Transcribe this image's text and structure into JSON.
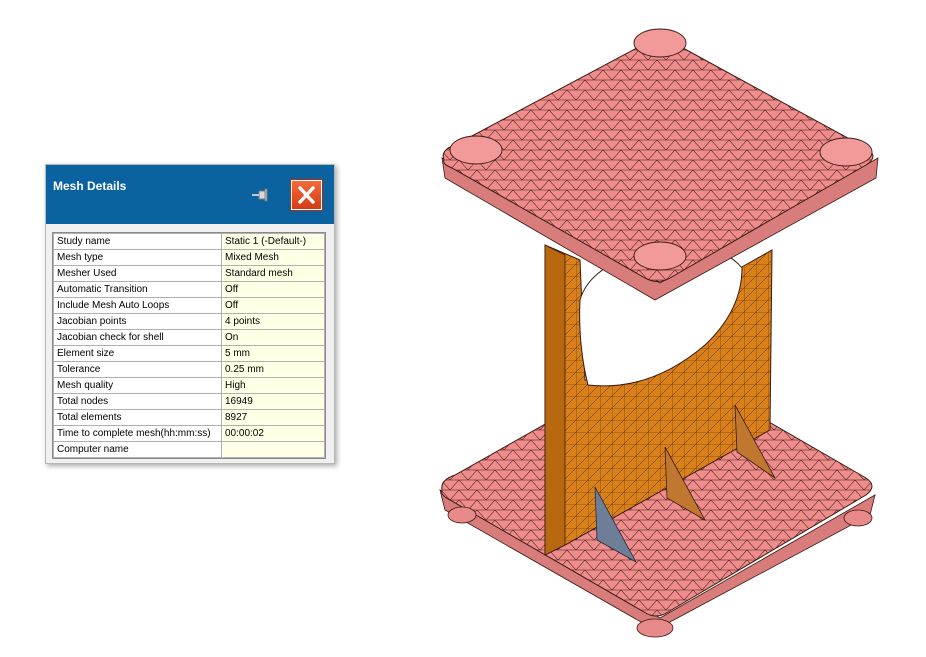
{
  "panel": {
    "title": "Mesh Details",
    "pin_icon": "pin-icon",
    "close_icon": "close-icon",
    "close_color": "#e2451f",
    "header_color": "#0a62a0",
    "rows": [
      {
        "key": "Study name",
        "value": "Static 1 (-Default-)"
      },
      {
        "key": "Mesh type",
        "value": "Mixed Mesh"
      },
      {
        "key": "Mesher Used",
        "value": "Standard mesh"
      },
      {
        "key": "Automatic Transition",
        "value": "Off"
      },
      {
        "key": "Include Mesh Auto Loops",
        "value": "Off"
      },
      {
        "key": "Jacobian points",
        "value": "4 points"
      },
      {
        "key": "Jacobian check for shell",
        "value": "On"
      },
      {
        "key": "Element size",
        "value": "5 mm"
      },
      {
        "key": "Tolerance",
        "value": "0.25 mm"
      },
      {
        "key": "Mesh quality",
        "value": "High"
      },
      {
        "key": "Total nodes",
        "value": "16949"
      },
      {
        "key": "Total elements",
        "value": "8927"
      },
      {
        "key": "Time to complete mesh(hh:mm:ss)",
        "value": "00:00:02"
      },
      {
        "key": "Computer name",
        "value": ""
      }
    ]
  },
  "viewport": {
    "model_colors": {
      "plate": "#f08c8c",
      "rib": "#d9801a",
      "gusset": "#6e7e96",
      "mesh_lines": "#3a1a12"
    }
  }
}
